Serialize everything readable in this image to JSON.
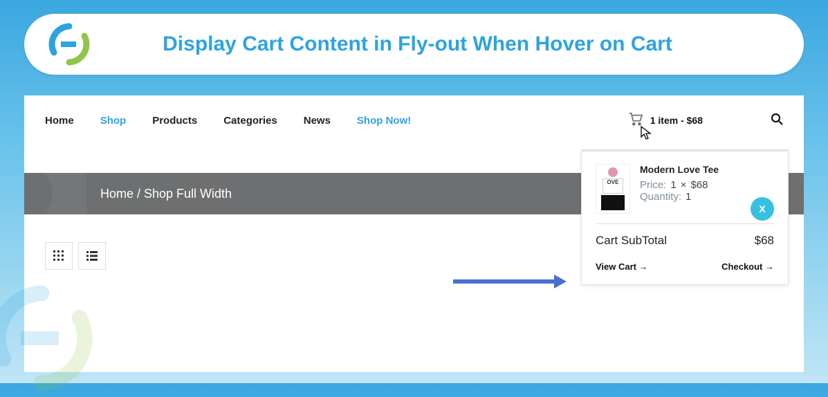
{
  "header": {
    "title": "Display Cart Content in Fly-out When Hover on Cart"
  },
  "nav": {
    "items": [
      {
        "label": "Home",
        "active": false
      },
      {
        "label": "Shop",
        "active": true
      },
      {
        "label": "Products",
        "active": false
      },
      {
        "label": "Categories",
        "active": false
      },
      {
        "label": "News",
        "active": false
      },
      {
        "label": "Shop Now!",
        "active": true
      }
    ]
  },
  "cart_summary": {
    "text": "1 item - $68"
  },
  "breadcrumb": {
    "text": "Home / Shop Full Width"
  },
  "flyout": {
    "item": {
      "name": "Modern Love Tee",
      "price_label": "Price:",
      "price_qty": "1",
      "price_times": "×",
      "price_each": "$68",
      "qty_label": "Quantity:",
      "qty_value": "1",
      "remove_label": "X"
    },
    "subtotal_label": "Cart SubTotal",
    "subtotal_value": "$68",
    "view_cart": "View Cart →",
    "checkout": "Checkout →"
  }
}
